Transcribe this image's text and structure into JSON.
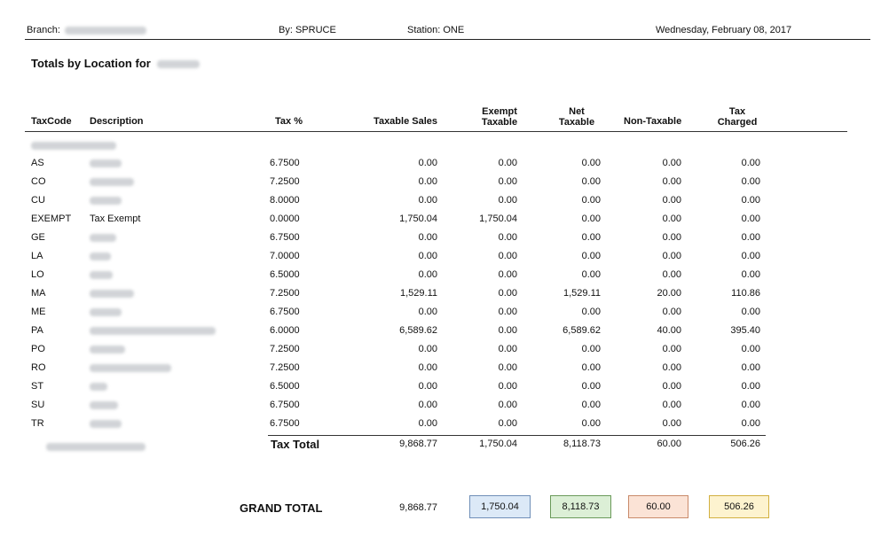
{
  "header": {
    "branch_label": "Branch:",
    "by": "By: SPRUCE",
    "station": "Station: ONE",
    "date": "Wednesday, February 08, 2017"
  },
  "report": {
    "title": "Totals by Location for"
  },
  "columns": {
    "taxcode": "TaxCode",
    "description": "Description",
    "tax_pct": "Tax %",
    "taxable_sales": "Taxable Sales",
    "exempt_taxable_1": "Exempt",
    "exempt_taxable_2": "Taxable",
    "net_taxable_1": "Net",
    "net_taxable_2": "Taxable",
    "non_taxable": "Non-Taxable",
    "tax_charged_1": "Tax",
    "tax_charged_2": "Charged"
  },
  "rows": [
    {
      "code": "AS",
      "desc": "",
      "tax": "6.7500",
      "sales": "0.00",
      "exempt": "0.00",
      "net": "0.00",
      "nontax": "0.00",
      "charged": "0.00"
    },
    {
      "code": "CO",
      "desc": "",
      "tax": "7.2500",
      "sales": "0.00",
      "exempt": "0.00",
      "net": "0.00",
      "nontax": "0.00",
      "charged": "0.00"
    },
    {
      "code": "CU",
      "desc": "",
      "tax": "8.0000",
      "sales": "0.00",
      "exempt": "0.00",
      "net": "0.00",
      "nontax": "0.00",
      "charged": "0.00"
    },
    {
      "code": "EXEMPT",
      "desc": "Tax Exempt",
      "tax": "0.0000",
      "sales": "1,750.04",
      "exempt": "1,750.04",
      "net": "0.00",
      "nontax": "0.00",
      "charged": "0.00"
    },
    {
      "code": "GE",
      "desc": "",
      "tax": "6.7500",
      "sales": "0.00",
      "exempt": "0.00",
      "net": "0.00",
      "nontax": "0.00",
      "charged": "0.00"
    },
    {
      "code": "LA",
      "desc": "",
      "tax": "7.0000",
      "sales": "0.00",
      "exempt": "0.00",
      "net": "0.00",
      "nontax": "0.00",
      "charged": "0.00"
    },
    {
      "code": "LO",
      "desc": "",
      "tax": "6.5000",
      "sales": "0.00",
      "exempt": "0.00",
      "net": "0.00",
      "nontax": "0.00",
      "charged": "0.00"
    },
    {
      "code": "MA",
      "desc": "",
      "tax": "7.2500",
      "sales": "1,529.11",
      "exempt": "0.00",
      "net": "1,529.11",
      "nontax": "20.00",
      "charged": "110.86"
    },
    {
      "code": "ME",
      "desc": "",
      "tax": "6.7500",
      "sales": "0.00",
      "exempt": "0.00",
      "net": "0.00",
      "nontax": "0.00",
      "charged": "0.00"
    },
    {
      "code": "PA",
      "desc": "",
      "tax": "6.0000",
      "sales": "6,589.62",
      "exempt": "0.00",
      "net": "6,589.62",
      "nontax": "40.00",
      "charged": "395.40"
    },
    {
      "code": "PO",
      "desc": "",
      "tax": "7.2500",
      "sales": "0.00",
      "exempt": "0.00",
      "net": "0.00",
      "nontax": "0.00",
      "charged": "0.00"
    },
    {
      "code": "RO",
      "desc": "",
      "tax": "7.2500",
      "sales": "0.00",
      "exempt": "0.00",
      "net": "0.00",
      "nontax": "0.00",
      "charged": "0.00"
    },
    {
      "code": "ST",
      "desc": "",
      "tax": "6.5000",
      "sales": "0.00",
      "exempt": "0.00",
      "net": "0.00",
      "nontax": "0.00",
      "charged": "0.00"
    },
    {
      "code": "SU",
      "desc": "",
      "tax": "6.7500",
      "sales": "0.00",
      "exempt": "0.00",
      "net": "0.00",
      "nontax": "0.00",
      "charged": "0.00"
    },
    {
      "code": "TR",
      "desc": "",
      "tax": "6.7500",
      "sales": "0.00",
      "exempt": "0.00",
      "net": "0.00",
      "nontax": "0.00",
      "charged": "0.00"
    }
  ],
  "tax_total": {
    "label": "Tax Total",
    "sales": "9,868.77",
    "exempt": "1,750.04",
    "net": "8,118.73",
    "nontax": "60.00",
    "charged": "506.26"
  },
  "grand_total": {
    "label": "GRAND TOTAL",
    "sales": "9,868.77",
    "exempt": "1,750.04",
    "net": "8,118.73",
    "nontax": "60.00",
    "charged": "506.26"
  },
  "box_colors": {
    "exempt": {
      "bg": "#dce9f7",
      "border": "#6f8fb8"
    },
    "net": {
      "bg": "#dcefd6",
      "border": "#6a9a5a"
    },
    "nontax": {
      "bg": "#fbe3d6",
      "border": "#c98a6a"
    },
    "charged": {
      "bg": "#fdf3cf",
      "border": "#d2b040"
    }
  }
}
